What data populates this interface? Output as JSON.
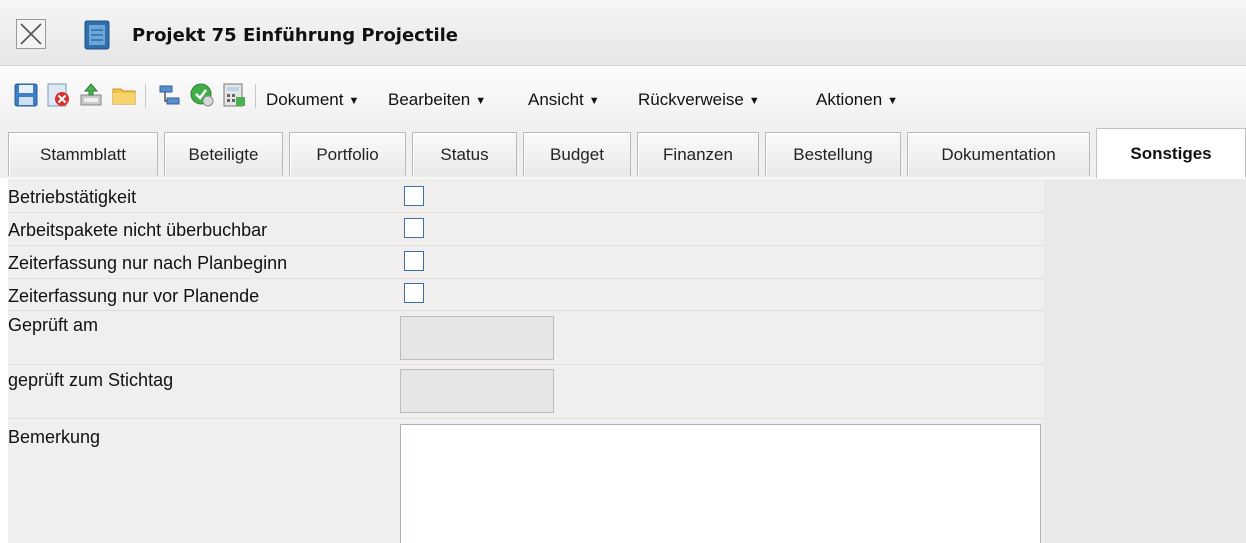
{
  "window": {
    "title": "Projekt 75 Einführung Projectile"
  },
  "toolbar": {
    "icons": [
      "save-icon",
      "delete-icon",
      "export-icon",
      "folder-icon",
      "hierarchy-icon",
      "check-icon",
      "calculator-icon"
    ],
    "menus": [
      {
        "label": "Dokument"
      },
      {
        "label": "Bearbeiten"
      },
      {
        "label": "Ansicht"
      },
      {
        "label": "Rückverweise"
      },
      {
        "label": "Aktionen"
      }
    ]
  },
  "tabs": [
    {
      "label": "Stammblatt"
    },
    {
      "label": "Beteiligte"
    },
    {
      "label": "Portfolio"
    },
    {
      "label": "Status"
    },
    {
      "label": "Budget"
    },
    {
      "label": "Finanzen"
    },
    {
      "label": "Bestellung"
    },
    {
      "label": "Dokumentation"
    },
    {
      "label": "Sonstiges",
      "active": true
    }
  ],
  "form": {
    "betriebstaetigkeit": {
      "label": "Betriebstätigkeit",
      "checked": false
    },
    "arbeitspakete": {
      "label": "Arbeitspakete nicht überbuchbar",
      "checked": false
    },
    "zeit_planbeginn": {
      "label": "Zeiterfassung nur nach Planbeginn",
      "checked": false
    },
    "zeit_planende": {
      "label": "Zeiterfassung nur vor Planende",
      "checked": false
    },
    "geprueft_am": {
      "label": "Geprüft am",
      "value": ""
    },
    "geprueft_stichtag": {
      "label": "geprüft zum Stichtag",
      "value": ""
    },
    "bemerkung": {
      "label": "Bemerkung",
      "value": ""
    }
  },
  "colors": {
    "form_bg": "#f1efee",
    "checkbox_border": "#3a6fa8"
  }
}
